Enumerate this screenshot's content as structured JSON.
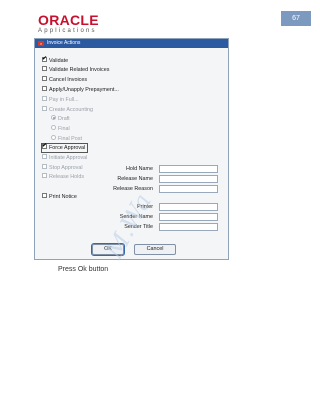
{
  "page_number": "67",
  "logo": {
    "brand": "ORACLE",
    "sub": "Applications"
  },
  "dialog": {
    "title": "Invoice Actions",
    "options": [
      {
        "label": "Validate",
        "checked": true,
        "enabled": true
      },
      {
        "label": "Validate Related Invoices",
        "checked": false,
        "enabled": true
      },
      {
        "label": "Cancel Invoices",
        "checked": false,
        "enabled": true
      },
      {
        "label": "Apply/Unapply Prepayment...",
        "checked": false,
        "enabled": true
      },
      {
        "label": "Pay in Full...",
        "checked": false,
        "enabled": false
      },
      {
        "label": "Create Accounting",
        "checked": false,
        "enabled": false
      }
    ],
    "accounting_modes": [
      {
        "label": "Draft",
        "selected": true
      },
      {
        "label": "Final",
        "selected": false
      },
      {
        "label": "Final Post",
        "selected": false
      }
    ],
    "options2": [
      {
        "label": "Force Approval",
        "checked": true,
        "enabled": true
      },
      {
        "label": "Initiate Approval",
        "checked": false,
        "enabled": false
      },
      {
        "label": "Stop Approval",
        "checked": false,
        "enabled": false
      },
      {
        "label": "Release Holds",
        "checked": false,
        "enabled": false
      }
    ],
    "hold_fields": [
      {
        "label": "Hold Name",
        "value": ""
      },
      {
        "label": "Release Name",
        "value": ""
      },
      {
        "label": "Release Reason",
        "value": ""
      }
    ],
    "print_notice": {
      "label": "Print Notice",
      "checked": false
    },
    "print_fields": [
      {
        "label": "Printer",
        "value": ""
      },
      {
        "label": "Sender Name",
        "value": ""
      },
      {
        "label": "Sender Title",
        "value": ""
      }
    ],
    "ok_label": "OK",
    "cancel_label": "Cancel"
  },
  "caption": "Press Ok button",
  "watermark": "M.Wa"
}
